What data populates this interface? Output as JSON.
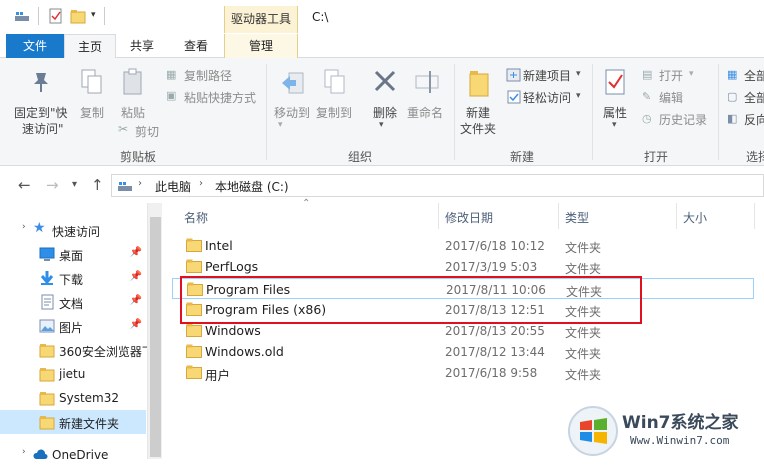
{
  "window": {
    "title": "C:\\",
    "context_tab": "驱动器工具"
  },
  "tabs": [
    {
      "label": "文件"
    },
    {
      "label": "主页"
    },
    {
      "label": "共享"
    },
    {
      "label": "查看"
    },
    {
      "label": "管理"
    }
  ],
  "ribbon": {
    "clipboard": {
      "pin": "固定到\"快",
      "pin2": "速访问\"",
      "copy": "复制",
      "paste": "粘贴",
      "copy_path": "复制路径",
      "paste_shortcut": "粘贴快捷方式",
      "cut": "剪切",
      "label": "剪贴板"
    },
    "organize": {
      "move_to": "移动到",
      "copy_to": "复制到",
      "delete": "删除",
      "rename": "重命名",
      "label": "组织"
    },
    "new": {
      "new_folder": "新建",
      "new_folder2": "文件夹",
      "new_item": "新建项目",
      "easy_access": "轻松访问",
      "label": "新建"
    },
    "open": {
      "properties": "属性",
      "open": "打开",
      "edit": "编辑",
      "history": "历史记录",
      "label": "打开"
    },
    "select": {
      "select_all": "全部",
      "select_none": "全部",
      "invert": "反向",
      "label": "选择"
    }
  },
  "address": {
    "crumbs": [
      "此电脑",
      "本地磁盘 (C:)"
    ]
  },
  "nav": {
    "quick_access": "快速访问",
    "items": [
      {
        "label": "桌面",
        "icon": "desktop-icon",
        "pinned": true
      },
      {
        "label": "下载",
        "icon": "download-icon",
        "pinned": true
      },
      {
        "label": "文档",
        "icon": "document-icon",
        "pinned": true
      },
      {
        "label": "图片",
        "icon": "picture-icon",
        "pinned": true
      },
      {
        "label": "360安全浏览器下",
        "icon": "folder-icon",
        "pinned": false
      },
      {
        "label": "jietu",
        "icon": "folder-icon",
        "pinned": false
      },
      {
        "label": "System32",
        "icon": "folder-icon",
        "pinned": false
      },
      {
        "label": "新建文件夹",
        "icon": "folder-icon",
        "pinned": false
      }
    ],
    "onedrive": "OneDrive"
  },
  "columns": {
    "name": "名称",
    "date": "修改日期",
    "type": "类型",
    "size": "大小"
  },
  "files": [
    {
      "name": "Intel",
      "date": "2017/6/18 10:12",
      "type": "文件夹"
    },
    {
      "name": "PerfLogs",
      "date": "2017/3/19 5:03",
      "type": "文件夹"
    },
    {
      "name": "Program Files",
      "date": "2017/8/11 10:06",
      "type": "文件夹"
    },
    {
      "name": "Program Files (x86)",
      "date": "2017/8/13 12:51",
      "type": "文件夹"
    },
    {
      "name": "Windows",
      "date": "2017/8/13 20:55",
      "type": "文件夹"
    },
    {
      "name": "Windows.old",
      "date": "2017/8/12 13:44",
      "type": "文件夹"
    },
    {
      "name": "用户",
      "date": "2017/6/18 9:58",
      "type": "文件夹"
    }
  ],
  "watermark": {
    "brand": "Win7系统之家",
    "url": "Www.Winwin7.com"
  },
  "colors": {
    "file_tab": "#1979ca",
    "highlight": "#e0101e",
    "folder": "#f8d775"
  }
}
